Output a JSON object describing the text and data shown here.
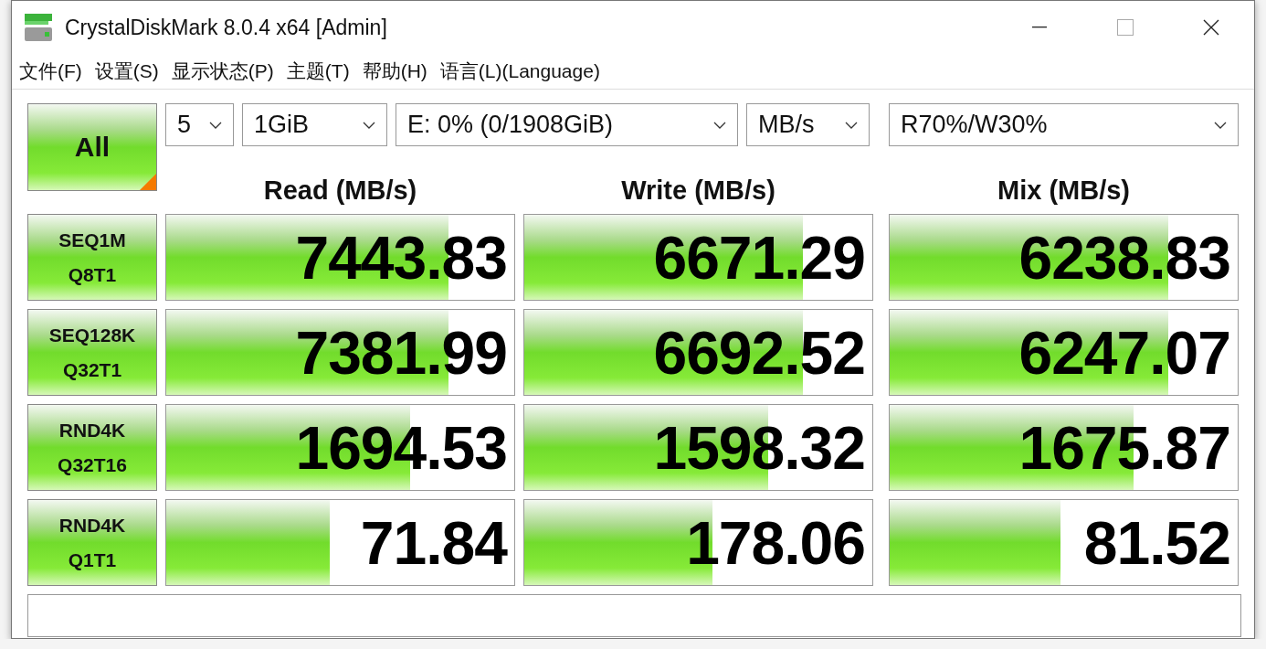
{
  "window": {
    "title": "CrystalDiskMark 8.0.4 x64 [Admin]"
  },
  "menu": [
    "文件(F)",
    "设置(S)",
    "显示状态(P)",
    "主题(T)",
    "帮助(H)",
    "语言(L)(Language)"
  ],
  "all_button": {
    "label": "All"
  },
  "selectors": [
    {
      "value": "5"
    },
    {
      "value": "1GiB"
    },
    {
      "value": "E: 0% (0/1908GiB)"
    },
    {
      "value": "MB/s"
    }
  ],
  "mix_selector": {
    "value": "R70%/W30%"
  },
  "columns": [
    "Read (MB/s)",
    "Write (MB/s)",
    "Mix (MB/s)"
  ],
  "tests": [
    {
      "name": "SEQ1M",
      "params": "Q8T1",
      "results": [
        {
          "value": "7443.83",
          "level": 0.81
        },
        {
          "value": "6671.29",
          "level": 0.8
        },
        {
          "value": "6238.83",
          "level": 0.8
        }
      ]
    },
    {
      "name": "SEQ128K",
      "params": "Q32T1",
      "results": [
        {
          "value": "7381.99",
          "level": 0.81
        },
        {
          "value": "6692.52",
          "level": 0.8
        },
        {
          "value": "6247.07",
          "level": 0.8
        }
      ]
    },
    {
      "name": "RND4K",
      "params": "Q32T16",
      "results": [
        {
          "value": "1694.53",
          "level": 0.7
        },
        {
          "value": "1598.32",
          "level": 0.7
        },
        {
          "value": "1675.87",
          "level": 0.7
        }
      ]
    },
    {
      "name": "RND4K",
      "params": "Q1T1",
      "results": [
        {
          "value": "71.84",
          "level": 0.47
        },
        {
          "value": "178.06",
          "level": 0.54
        },
        {
          "value": "81.52",
          "level": 0.49
        }
      ]
    }
  ]
}
